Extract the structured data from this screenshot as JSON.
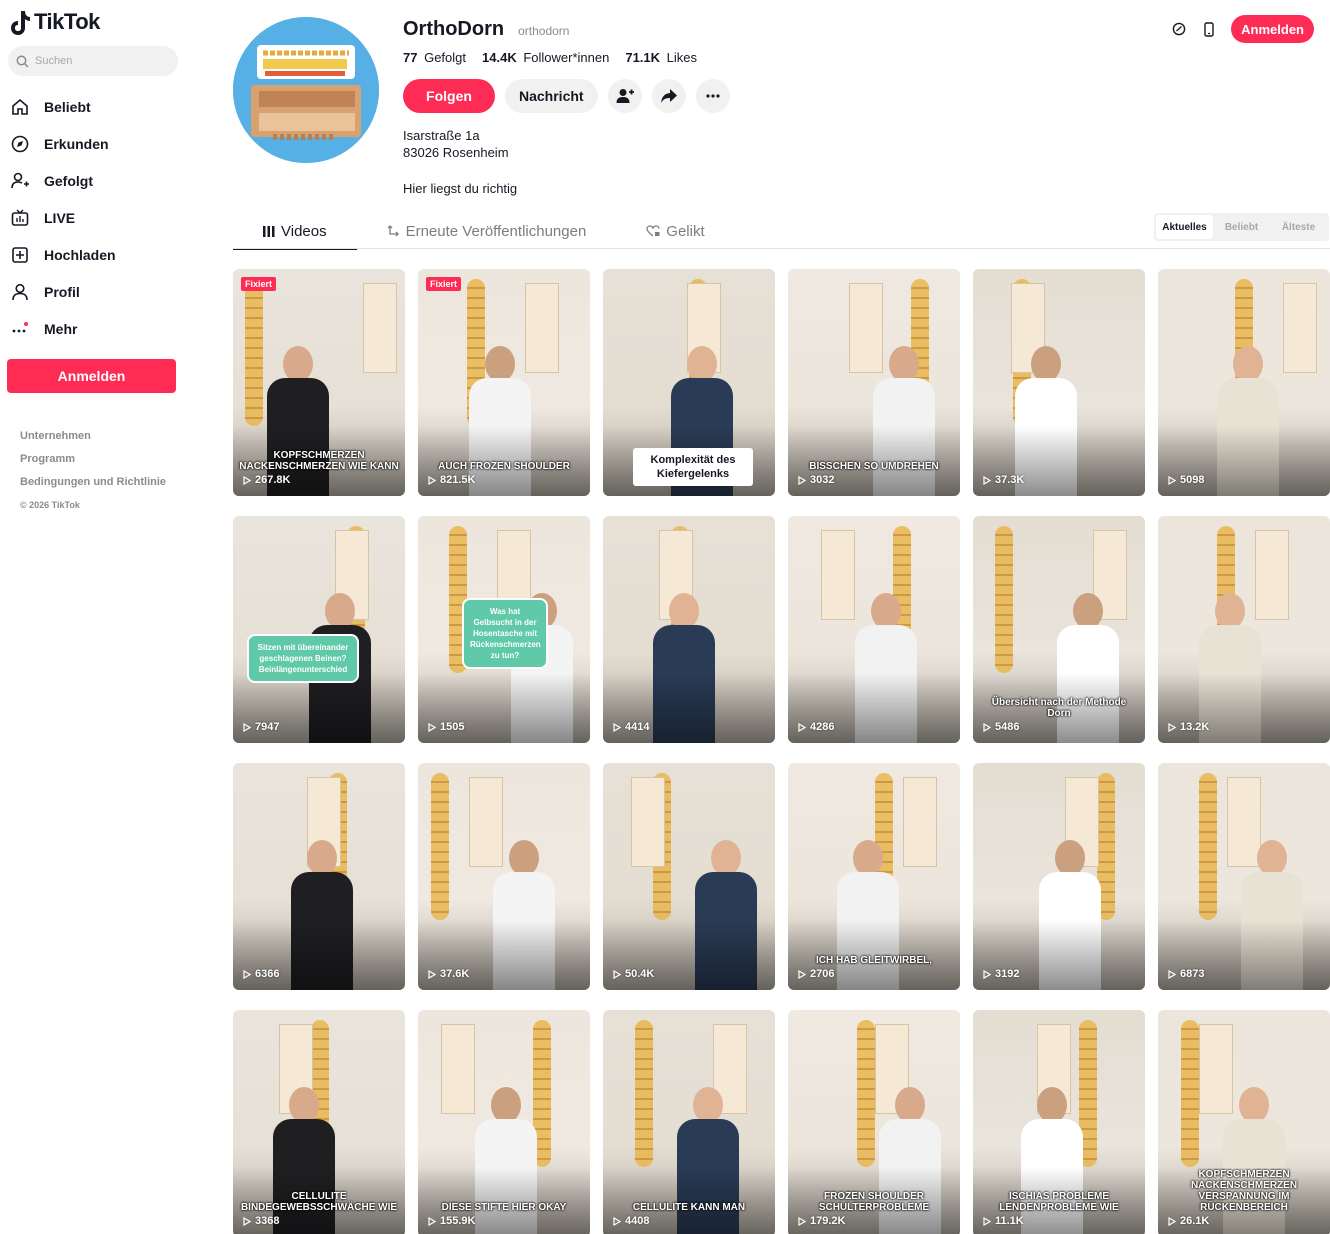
{
  "app": {
    "logo_text": "TikTok"
  },
  "sidebar": {
    "search_placeholder": "Suchen",
    "items": [
      {
        "label": "Beliebt",
        "icon": "home-icon"
      },
      {
        "label": "Erkunden",
        "icon": "compass-icon"
      },
      {
        "label": "Gefolgt",
        "icon": "follow-icon"
      },
      {
        "label": "LIVE",
        "icon": "live-icon"
      },
      {
        "label": "Hochladen",
        "icon": "upload-icon"
      },
      {
        "label": "Profil",
        "icon": "profile-icon"
      },
      {
        "label": "Mehr",
        "icon": "more-icon"
      }
    ],
    "login_label": "Anmelden",
    "footer": [
      "Unternehmen",
      "Programm",
      "Bedingungen und Richtlinie",
      "© 2026 TikTok"
    ]
  },
  "topbar": {
    "login_label": "Anmelden"
  },
  "profile": {
    "name": "OrthoDorn",
    "handle": "orthodorn",
    "following_count": "77",
    "following_label": "Gefolgt",
    "followers_count": "14.4K",
    "followers_label": "Follower*innen",
    "likes_count": "71.1K",
    "likes_label": "Likes",
    "follow_label": "Folgen",
    "message_label": "Nachricht",
    "address_line1": "Isarstraße 1a",
    "address_line2": "83026 Rosenheim",
    "tagline": "Hier liegst du richtig"
  },
  "tabs": [
    {
      "label": "Videos",
      "icon": "grid-icon"
    },
    {
      "label": "Erneute Veröffentlichungen",
      "icon": "repost-icon"
    },
    {
      "label": "Gelikt",
      "icon": "heart-icon"
    }
  ],
  "sort": [
    "Aktuelles",
    "Beliebt",
    "Älteste"
  ],
  "pinned_label": "Fixiert",
  "videos": [
    {
      "views": "267.8K",
      "pinned": true,
      "caption": "KOPFSCHMERZEN NACKENSCHMERZEN WIE KANN"
    },
    {
      "views": "821.5K",
      "pinned": true,
      "caption": "AUCH FROZEN SHOULDER"
    },
    {
      "views": "",
      "caption_box": "Komplexität des Kiefergelenks"
    },
    {
      "views": "3032",
      "caption": "BISSCHEN SO UMDREHEN"
    },
    {
      "views": "37.3K"
    },
    {
      "views": "5098"
    },
    {
      "views": "7947",
      "bubble": "Sitzen mit übereinander geschlagenen Beinen? Beinlängenunterschied"
    },
    {
      "views": "1505",
      "bubble": "Was hat Gelbsucht in der Hosentasche mit Rückenschmerzen zu tun?"
    },
    {
      "views": "4414"
    },
    {
      "views": "4286"
    },
    {
      "views": "5486",
      "caption": "Übersicht nach der Methode Dorn"
    },
    {
      "views": "13.2K"
    },
    {
      "views": "6366"
    },
    {
      "views": "37.6K"
    },
    {
      "views": "50.4K"
    },
    {
      "views": "2706",
      "caption": "ICH HAB GLEITWIRBEL,"
    },
    {
      "views": "3192"
    },
    {
      "views": "6873"
    },
    {
      "views": "3368",
      "caption": "CELLULITE BINDEGEWEBSSCHWÄCHE WIE"
    },
    {
      "views": "155.9K",
      "caption": "DIESE STIFTE HIER OKAY"
    },
    {
      "views": "4408",
      "caption": "CELLULITE KANN MAN"
    },
    {
      "views": "179.2K",
      "caption": "FROZEN SHOULDER SCHULTERPROBLEME"
    },
    {
      "views": "11.1K",
      "caption": "ISCHIAS PROBLEME LENDENPROBLEME WIE"
    },
    {
      "views": "26.1K",
      "caption": "KOPFSCHMERZEN NACKENSCHMERZEN VERSPANNUNG IM RÜCKENBEREICH"
    }
  ],
  "colors": {
    "accent": "#fe2c55",
    "text": "#161823",
    "muted": "#8a8b91"
  }
}
